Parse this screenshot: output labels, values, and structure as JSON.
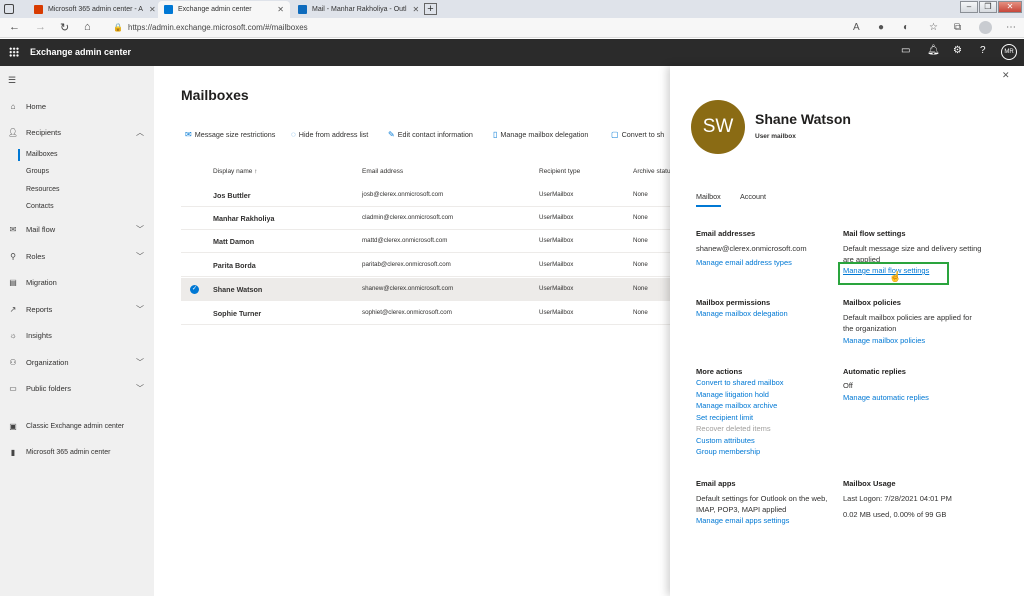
{
  "browser": {
    "tabs": [
      {
        "title": "Microsoft 365 admin center - A"
      },
      {
        "title": "Exchange admin center"
      },
      {
        "title": "Mail - Manhar Rakholiya - Outl"
      }
    ],
    "url": "https://admin.exchange.microsoft.com/#/mailboxes"
  },
  "header": {
    "title": "Exchange admin center",
    "user_initials": "MR"
  },
  "nav": {
    "items": [
      {
        "label": "Home",
        "icon": "home-icon"
      },
      {
        "label": "Recipients",
        "icon": "person-icon"
      },
      {
        "label": "Mail flow",
        "icon": "mail-icon"
      },
      {
        "label": "Roles",
        "icon": "roles-icon"
      },
      {
        "label": "Migration",
        "icon": "migration-icon"
      },
      {
        "label": "Reports",
        "icon": "reports-icon"
      },
      {
        "label": "Insights",
        "icon": "lightbulb-icon"
      },
      {
        "label": "Organization",
        "icon": "organization-icon"
      },
      {
        "label": "Public folders",
        "icon": "folder-icon"
      },
      {
        "label": "Classic Exchange admin center",
        "icon": "exchange-icon"
      },
      {
        "label": "Microsoft 365 admin center",
        "icon": "office-icon"
      }
    ],
    "recipients_sub": [
      "Mailboxes",
      "Groups",
      "Resources",
      "Contacts"
    ]
  },
  "main": {
    "title": "Mailboxes",
    "commands": [
      "Message size restrictions",
      "Hide from address list",
      "Edit contact information",
      "Manage mailbox delegation",
      "Convert to sh"
    ],
    "columns": [
      "Display name",
      "Email address",
      "Recipient type",
      "Archive status"
    ],
    "sort_arrow": "↑",
    "rows": [
      {
        "name": "Jos Buttler",
        "email": "josb@clerex.onmicrosoft.com",
        "type": "UserMailbox",
        "archive": "None"
      },
      {
        "name": "Manhar Rakholiya",
        "email": "cladmin@clerex.onmicrosoft.com",
        "type": "UserMailbox",
        "archive": "None"
      },
      {
        "name": "Matt Damon",
        "email": "mattd@clerex.onmicrosoft.com",
        "type": "UserMailbox",
        "archive": "None"
      },
      {
        "name": "Parita Borda",
        "email": "paritab@clerex.onmicrosoft.com",
        "type": "UserMailbox",
        "archive": "None"
      },
      {
        "name": "Shane Watson",
        "email": "shanew@clerex.onmicrosoft.com",
        "type": "UserMailbox",
        "archive": "None"
      },
      {
        "name": "Sophie Turner",
        "email": "sophiet@clerex.onmicrosoft.com",
        "type": "UserMailbox",
        "archive": "None"
      }
    ]
  },
  "panel": {
    "initials": "SW",
    "name": "Shane Watson",
    "subtitle": "User mailbox",
    "tabs": [
      "Mailbox",
      "Account"
    ],
    "email_addresses": {
      "heading": "Email addresses",
      "value": "shanew@clerex.onmicrosoft.com",
      "link": "Manage email address types"
    },
    "mail_flow": {
      "heading": "Mail flow settings",
      "text": "Default message size and delivery setting are applied",
      "link": "Manage mail flow settings"
    },
    "permissions": {
      "heading": "Mailbox permissions",
      "link": "Manage mailbox delegation"
    },
    "policies": {
      "heading": "Mailbox policies",
      "text": "Default mailbox policies are applied for the organization",
      "link": "Manage mailbox policies"
    },
    "more_actions": {
      "heading": "More actions",
      "links": [
        "Convert to shared mailbox",
        "Manage litigation hold",
        "Manage mailbox archive",
        "Set recipient limit"
      ],
      "disabled": "Recover deleted items",
      "links2": [
        "Custom attributes",
        "Group membership"
      ]
    },
    "auto_replies": {
      "heading": "Automatic replies",
      "value": "Off",
      "link": "Manage automatic replies"
    },
    "email_apps": {
      "heading": "Email apps",
      "text": "Default settings for Outlook on the web, IMAP, POP3, MAPI applied",
      "link": "Manage email apps settings"
    },
    "usage": {
      "heading": "Mailbox Usage",
      "last_logon": "Last Logon: 7/28/2021 04:01 PM",
      "used": "0.02 MB used, 0.00% of 99 GB"
    }
  },
  "colors": {
    "accent": "#0078d4",
    "highlight": "#2aa43d",
    "avatar": "#8a6b14"
  }
}
